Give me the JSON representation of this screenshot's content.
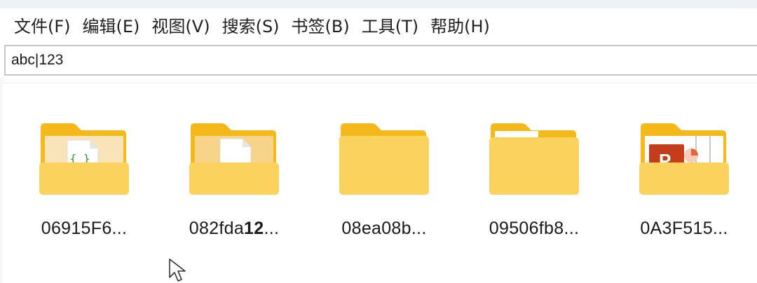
{
  "menu": [
    "文件(F)",
    "编辑(E)",
    "视图(V)",
    "搜索(S)",
    "书签(B)",
    "工具(T)",
    "帮助(H)"
  ],
  "search": {
    "value": "abc|123"
  },
  "files": [
    {
      "name": "06915F6...",
      "thumb": "code-file-icon"
    },
    {
      "name_prefix": "082fda",
      "name_bold": "12",
      "name_suffix": "...",
      "thumb": "document-icon"
    },
    {
      "name": "08ea08b...",
      "thumb": "none"
    },
    {
      "name": "09506fb8...",
      "thumb": "paper-icon"
    },
    {
      "name": "0A3F515...",
      "thumb": "powerpoint-icon"
    }
  ],
  "colors": {
    "folder_back": "#f4b81a",
    "folder_front": "#fcd25e",
    "accent_ppt": "#c43e1c"
  }
}
